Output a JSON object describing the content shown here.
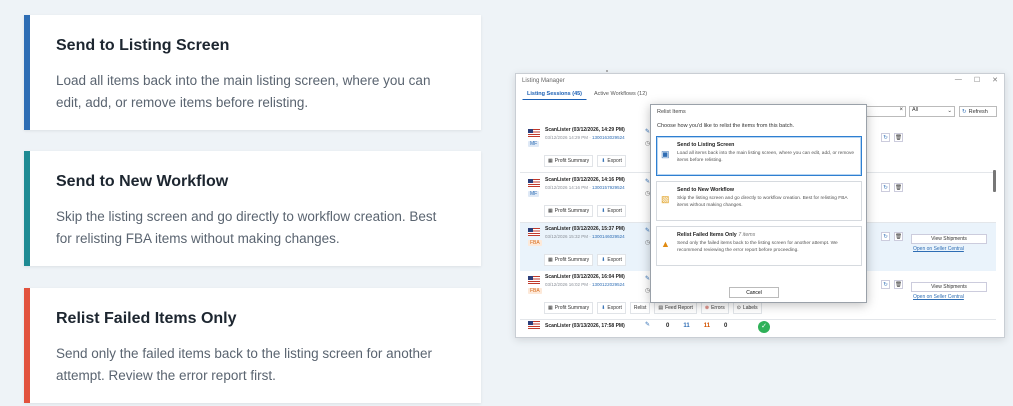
{
  "cards": [
    {
      "title": "Send to Listing Screen",
      "desc": "Load all items back into the main listing screen, where you can edit, add, or remove items before relisting.",
      "color": "#2e6db4"
    },
    {
      "title": "Send to New Workflow",
      "desc": "Skip the listing screen and go directly to workflow creation. Best for relisting FBA items without making changes.",
      "color": "#1f8a93"
    },
    {
      "title": "Relist Failed Items Only",
      "desc": "Send only the failed items back to the listing screen for another attempt. Review the error report first.",
      "color": "#e2523d"
    }
  ],
  "window": {
    "title": "Listing Manager",
    "tabs": [
      "Listing Sessions (45)",
      "Active Workflows (12)"
    ],
    "filter_value": "All",
    "refresh_label": "Refresh",
    "clear_glyph": "×"
  },
  "rows": [
    {
      "title": "ScanLister (03/12/2026, 14:29 PM)",
      "date": "03/12/2026 14:29 PM · ",
      "asin": "1300163029524",
      "badge": "MF",
      "summary": "Profit Summary",
      "export": "Export"
    },
    {
      "title": "ScanLister (03/12/2026, 14:16 PM)",
      "date": "03/12/2026 14:16 PM · ",
      "asin": "1300157929524",
      "badge": "MF",
      "summary": "Profit Summary",
      "export": "Export"
    },
    {
      "title": "ScanLister (03/12/2026, 15:37 PM)",
      "date": "03/12/2026 15:32 PM · ",
      "asin": "1300146029524",
      "badge": "FBA",
      "summary": "Profit Summary",
      "export": "Export",
      "view": "View Shipments",
      "seller": "Open on Seller Central"
    },
    {
      "title": "ScanLister (03/12/2026, 16:04 PM)",
      "date": "03/12/2026 16:02 PM · ",
      "asin": "1300122029524",
      "badge": "FBA",
      "summary": "Profit Summary",
      "export": "Export",
      "view": "View Shipments",
      "seller": "Open on Seller Central",
      "feed": "Feed Report",
      "errors": "Errors",
      "labels": "Labels",
      "relist": "Relist"
    }
  ],
  "last_row": {
    "title": "ScanLister (03/13/2026, 17:58 PM)",
    "counts": [
      "0",
      "11",
      "11",
      "0"
    ]
  },
  "dialog": {
    "title": "Relist Items",
    "prompt": "Choose how you'd like to relist the items from this batch.",
    "options": [
      {
        "title": "Send to Listing Screen",
        "count": "",
        "desc": "Load all items back into the main listing screen, where you can edit, add, or remove items before relisting.",
        "icon": "listing-screen-icon"
      },
      {
        "title": "Send to New Workflow",
        "count": "",
        "desc": "Skip the listing screen and go directly to workflow creation. Best for relisting FBA items without making changes.",
        "icon": "workflow-box-icon"
      },
      {
        "title": "Relist Failed Items Only",
        "count": "7 items",
        "desc": "Send only the failed items back to the listing screen for another attempt. We recommend reviewing the error report before proceeding.",
        "icon": "warning-icon"
      }
    ],
    "cancel_label": "Cancel"
  }
}
